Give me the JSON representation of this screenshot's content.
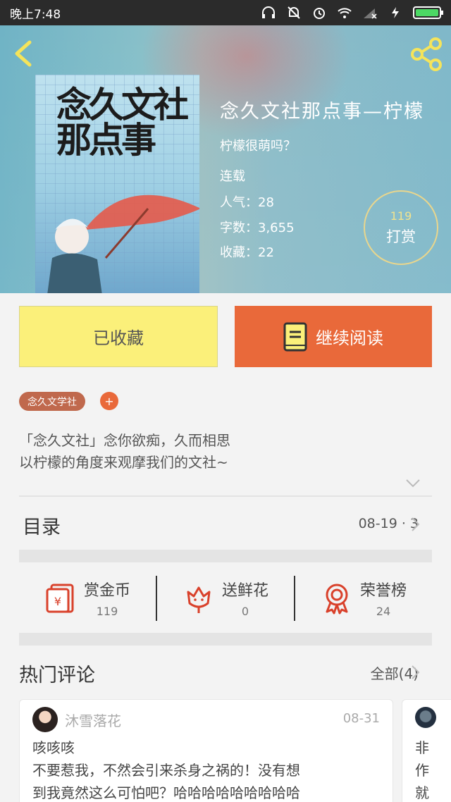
{
  "status_bar": {
    "time": "晚上7:48",
    "icons": [
      "headphones-icon",
      "mute-icon",
      "alarm-icon",
      "wifi-icon",
      "signal-icon",
      "charging-icon",
      "battery-icon"
    ]
  },
  "header": {
    "back_icon": "back-chevron-icon",
    "share_icon": "share-icon"
  },
  "book": {
    "cover_text": "念久文社那点事",
    "title": "念久文社那点事—柠檬",
    "author": "柠檬很萌吗？",
    "status": "连载",
    "popularity": "人气：28",
    "word_count": "字数：3,655",
    "favorites": "收藏：22",
    "tip_count": "119",
    "tip_label": "打赏"
  },
  "actions": {
    "saved_label": "已收藏",
    "read_label": "继续阅读"
  },
  "tags": {
    "tag": "念久文学社",
    "add": "+"
  },
  "description": {
    "line1": "「念久文社」念你欲痴，久而相思",
    "line2": "以柠檬的角度来观摩我们的文社~"
  },
  "catalog": {
    "label": "目录",
    "latest": "08-19 · 3"
  },
  "stats": [
    {
      "name": "赏金币",
      "value": "119",
      "icon": "red-packet-icon"
    },
    {
      "name": "送鲜花",
      "value": "0",
      "icon": "flower-icon"
    },
    {
      "name": "荣誉榜",
      "value": "24",
      "icon": "medal-icon"
    }
  ],
  "comments": {
    "label": "热门评论",
    "all": "全部(4)",
    "items": [
      {
        "user": "沐雪落花",
        "date": "08-31",
        "line1": "咳咳咳",
        "line2": "不要惹我，不然会引来杀身之祸的！没有想",
        "line3": "到我竟然这么可怕吧？哈哈哈哈哈哈哈哈哈"
      },
      {
        "line1": "非",
        "line2": "作",
        "line3": "就"
      }
    ]
  },
  "colors": {
    "accent": "#e9693a",
    "saved_bg": "#fbf07a",
    "tag_bg": "#c0694d",
    "icon_red": "#d9412b"
  }
}
